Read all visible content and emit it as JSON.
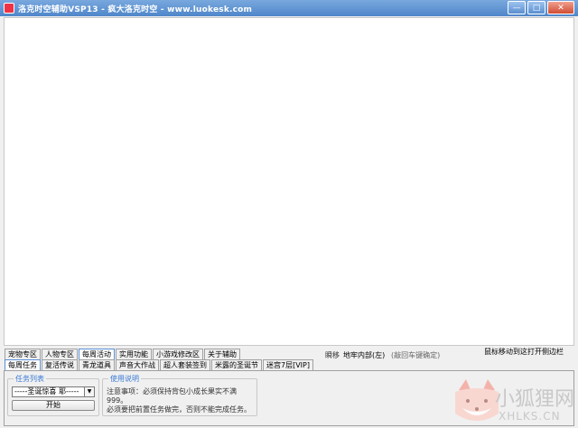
{
  "window": {
    "title": "洛克时空辅助VSP13 - 疯大洛克时空 - www.luokesk.com",
    "minimize_glyph": "—",
    "maximize_glyph": "□",
    "close_glyph": "✕"
  },
  "tabs_row1": [
    "宠物专区",
    "人物专区",
    "每周活动",
    "实用功能",
    "小游戏修改区",
    "关于辅助"
  ],
  "tabs_row1_active": "每周活动",
  "tabs_row2": [
    "每周任务",
    "复活传说",
    "青龙道具",
    "声音大作战",
    "超人套装签到",
    "米露的圣诞节",
    "迷宫7层[VIP]"
  ],
  "tabs_row2_active": "每周任务",
  "status": {
    "label": "瞬移",
    "location": "地牢内部(左)",
    "hint": "(敲回车键确定)",
    "right_hint": "鼠标移动到这打开侧边栏"
  },
  "task_group": {
    "legend": "任务列表",
    "selected": "-----圣诞惊喜 耶-----",
    "start_button": "开始"
  },
  "usage_group": {
    "legend": "使用说明",
    "line1": "注意事项：必须保持背包小成长果实不满999。",
    "line2": "必须要把前置任务做完，否则不能完成任务。"
  },
  "watermark": {
    "text_cn": "小狐狸网",
    "text_en": "XHLKS.CN"
  },
  "colors": {
    "titlebar": "#4f86c9",
    "legend": "#3b7ad6",
    "active_tab_border": "#5b8fd6"
  }
}
